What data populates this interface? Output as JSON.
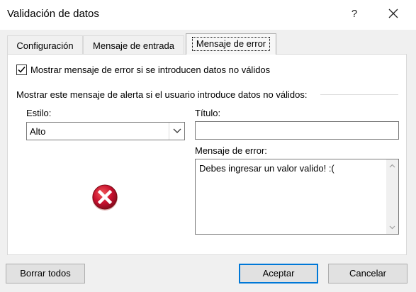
{
  "window": {
    "title": "Validación de datos",
    "help_label": "?"
  },
  "tabs": [
    {
      "label": "Configuración",
      "active": false
    },
    {
      "label": "Mensaje de entrada",
      "active": false
    },
    {
      "label": "Mensaje de error",
      "active": true
    }
  ],
  "error_tab": {
    "show_error_checkbox": {
      "label": "Mostrar mensaje de error si se introducen datos no válidos",
      "checked": true
    },
    "section_label": "Mostrar este mensaje de alerta si el usuario introduce datos no válidos:",
    "style": {
      "label": "Estilo:",
      "selected": "Alto",
      "options": [
        "Alto"
      ]
    },
    "title_field": {
      "label": "Título:",
      "value": ""
    },
    "error_message": {
      "label": "Mensaje de error:",
      "value": "Debes ingresar un valor valido! :("
    },
    "icon": "error-stop-icon"
  },
  "buttons": {
    "clear_all": "Borrar todos",
    "accept": "Aceptar",
    "cancel": "Cancelar"
  },
  "colors": {
    "accent": "#0078d7",
    "error_red": "#c8102e"
  }
}
